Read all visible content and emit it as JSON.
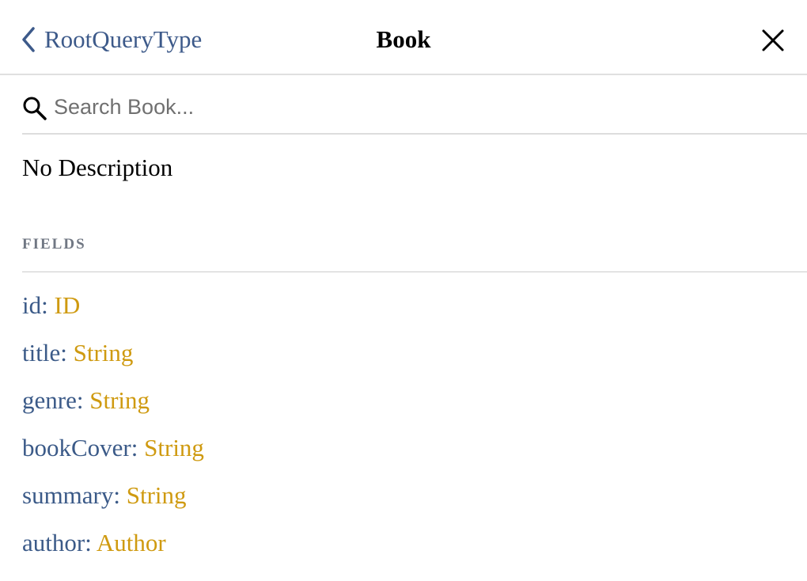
{
  "header": {
    "back_label": "RootQueryType",
    "title": "Book"
  },
  "search": {
    "placeholder": "Search Book...",
    "value": ""
  },
  "description": "No Description",
  "fields_section": {
    "title": "FIELDS",
    "fields": [
      {
        "name": "id",
        "type": "ID"
      },
      {
        "name": "title",
        "type": "String"
      },
      {
        "name": "genre",
        "type": "String"
      },
      {
        "name": "bookCover",
        "type": "String"
      },
      {
        "name": "summary",
        "type": "String"
      },
      {
        "name": "author",
        "type": "Author"
      }
    ]
  },
  "icons": {
    "back": "chevron-left-icon",
    "close": "close-icon",
    "search": "search-icon"
  },
  "colors": {
    "field_name": "#3b5a88",
    "field_type": "#cf9a10",
    "section_title": "#707783"
  }
}
